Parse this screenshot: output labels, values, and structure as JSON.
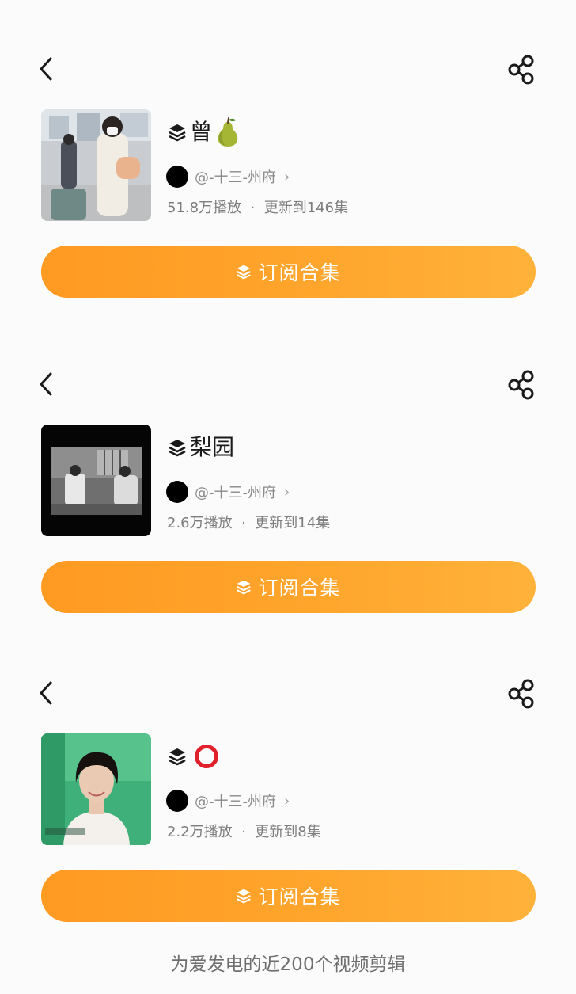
{
  "collections": [
    {
      "title": "曾",
      "title_emoji": "pear-emoji",
      "author": "@-十三-州府",
      "plays": "51.8万播放",
      "separator": "·",
      "updated": "更新到146集",
      "subscribe_label": "订阅合集"
    },
    {
      "title": "梨园",
      "title_emoji": "",
      "author": "@-十三-州府",
      "plays": "2.6万播放",
      "separator": "·",
      "updated": "更新到14集",
      "subscribe_label": "订阅合集"
    },
    {
      "title": "",
      "title_emoji": "red-circle-emoji",
      "author": "@-十三-州府",
      "plays": "2.2万播放",
      "separator": "·",
      "updated": "更新到8集",
      "subscribe_label": "订阅合集"
    }
  ],
  "footer_text": "为爱发电的近200个视频剪辑",
  "colors": {
    "accent": "#ffa52c",
    "accent_start": "#ff9a22",
    "accent_end": "#ffb23a",
    "background": "#fbfbfb",
    "title": "#1a1a1a",
    "meta": "#7d7d7d"
  }
}
